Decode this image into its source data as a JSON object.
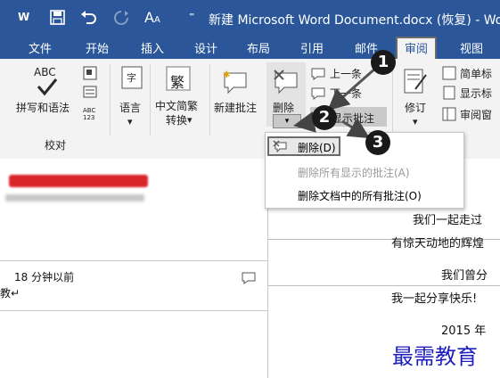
{
  "title_bar": {
    "word_icon": "W",
    "document_title": "新建 Microsoft Word Document.docx (恢复) - Wo"
  },
  "tabs": [
    {
      "label": "文件"
    },
    {
      "label": "开始"
    },
    {
      "label": "插入"
    },
    {
      "label": "设计"
    },
    {
      "label": "布局"
    },
    {
      "label": "引用"
    },
    {
      "label": "邮件"
    },
    {
      "label": "审阅",
      "active": true
    },
    {
      "label": "视图"
    }
  ],
  "ribbon": {
    "proofing": {
      "abc": "ABC",
      "spelling": "拼写和语法",
      "group": "校对",
      "abc_small": "ABC\n123"
    },
    "language": {
      "label": "语言"
    },
    "chinese": {
      "label1": "中文简繁",
      "label2": "转换",
      "glyph": "繁"
    },
    "new_comment": {
      "label": "新建批注"
    },
    "delete": {
      "label": "删除"
    },
    "prev": {
      "label": "上一条"
    },
    "next": {
      "label": "下一条"
    },
    "show_comments": {
      "label": "显示批注"
    },
    "track": {
      "label": "修订"
    },
    "simple_markup": {
      "label": "简单标"
    },
    "show_markup": {
      "label": "显示标"
    },
    "review_pane": {
      "label": "审阅窗"
    }
  },
  "dropdown": {
    "items": [
      {
        "label": "删除(D)",
        "enabled": true
      },
      {
        "label": "删除所有显示的批注(A)",
        "enabled": false
      },
      {
        "label": "删除文档中的所有批注(O)",
        "enabled": true
      }
    ]
  },
  "badges": [
    "1",
    "2",
    "3"
  ],
  "comment_pane": {
    "time": "18 分钟以前",
    "text_fragment": "教↵"
  },
  "document": {
    "lines": [
      "我们一起走过",
      "有惊天动地的辉煌",
      "我们曾分",
      "我一起分享快乐!",
      "2015 年"
    ]
  },
  "watermark": "最需教育"
}
